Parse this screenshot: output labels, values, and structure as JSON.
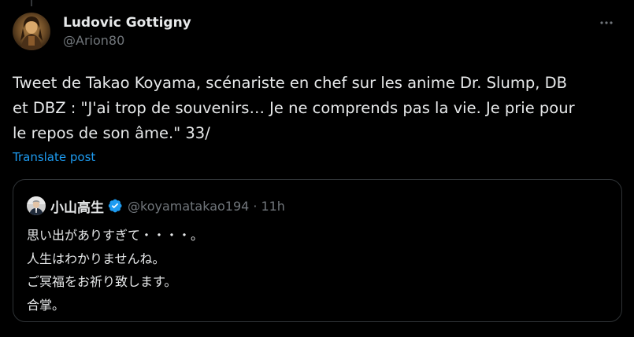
{
  "post": {
    "author": {
      "display_name": "Ludovic Gottigny",
      "handle": "@Arion80"
    },
    "more_icon": "more-horizontal-icon",
    "text": "Tweet de Takao Koyama, scénariste en chef sur les anime Dr. Slump, DB\net DBZ : \"J'ai trop de souvenirs… Je ne comprends pas la vie. Je prie pour\nle repos de son âme.\" 33/",
    "translate_label": "Translate post"
  },
  "quote": {
    "author": {
      "display_name": "小山高生",
      "handle": "@koyamatakao194",
      "separator": "·",
      "time": "11h"
    },
    "verified_icon": "verified-badge-icon",
    "lines": [
      "思い出がありすぎて・・・・。",
      "人生はわかりませんね。",
      "ご冥福をお祈り致します。",
      "合掌。"
    ]
  },
  "colors": {
    "background": "#000000",
    "text": "#e7e9ea",
    "secondary": "#71767b",
    "accent": "#1d9bf0",
    "border": "#2f3336"
  }
}
